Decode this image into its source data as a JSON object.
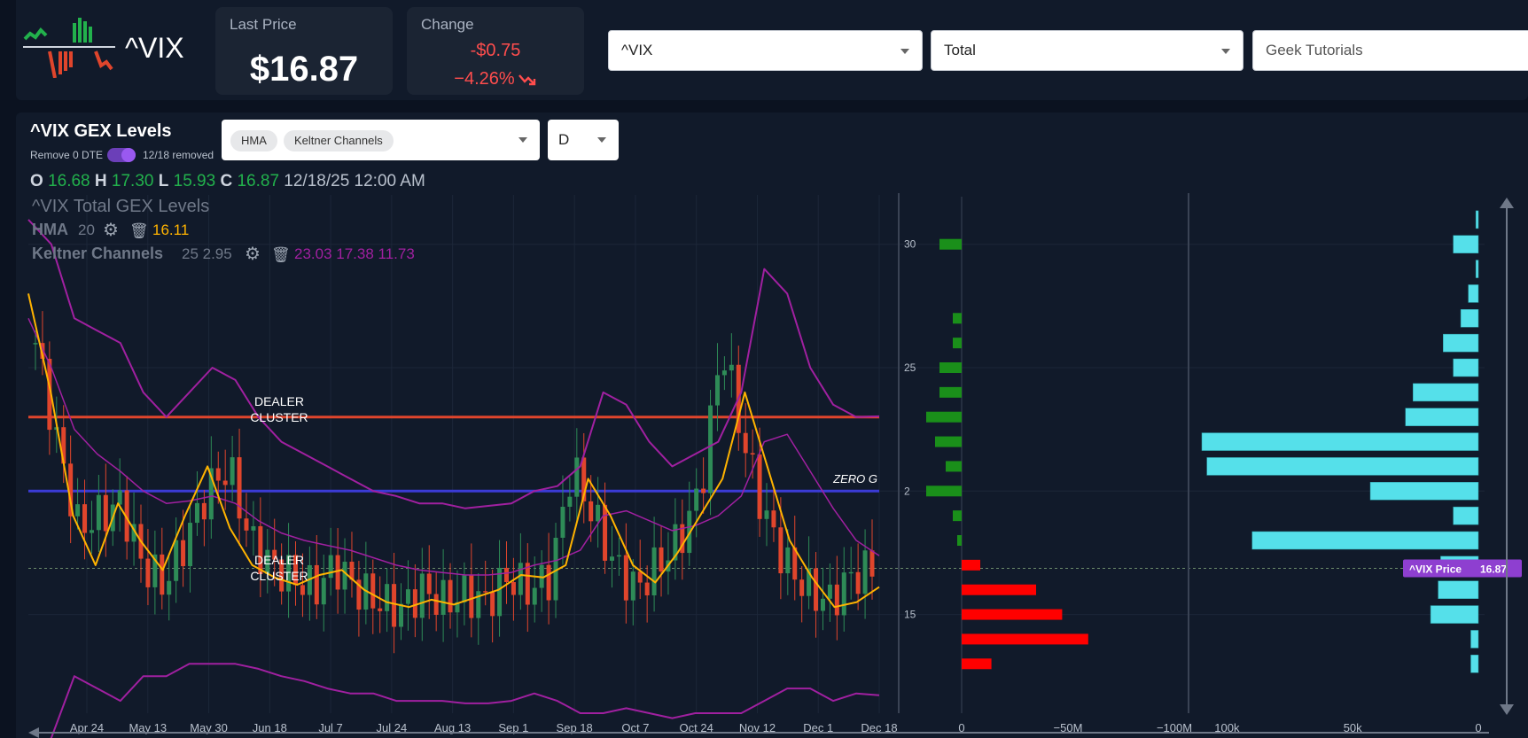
{
  "header": {
    "symbol": "^VIX",
    "last_price_label": "Last Price",
    "last_price": "$16.87",
    "change_label": "Change",
    "change_abs": "-$0.75",
    "change_pct": "−4.26%",
    "symbol_select": "^VIX",
    "gex_type_select": "Total",
    "tutorials_select": "Geek Tutorials"
  },
  "chart_panel": {
    "title": "^VIX GEX Levels",
    "remove_dte_label": "Remove 0 DTE",
    "removed_label": "12/18 removed",
    "indicator_chips": [
      "HMA",
      "Keltner Channels"
    ],
    "interval": "D",
    "ohlc": {
      "o": "16.68",
      "h": "17.30",
      "l": "15.93",
      "c": "16.87",
      "date": "12/18/25 12:00 AM"
    },
    "legend_series_title": "^VIX Total GEX Levels",
    "hma_label": "HMA",
    "hma_period": "20",
    "hma_value": "16.11",
    "keltner_label": "Keltner Channels",
    "keltner_params": "25 2.95",
    "keltner_values": "23.03 17.38 11.73",
    "annotations": {
      "dealer1": [
        "DEALER",
        "CLUSTER"
      ],
      "dealer2": [
        "DEALER",
        "CLUSTER"
      ],
      "zero_g": "ZERO G",
      "price_tag_label": "^VIX Price",
      "price_tag_value": "16.87"
    }
  },
  "colors": {
    "bull": "#2e8b57",
    "bear": "#e0452c",
    "hma": "#ffb300",
    "keltner": "#a020a0",
    "dealer_line": "#e0452c",
    "zero_line": "#3b3bd6",
    "gex_pos": "#1a8f1a",
    "gex_neg": "#ff0000",
    "oi": "#55e0ea",
    "price_tag": "#8e3fd0"
  },
  "chart_data": [
    {
      "type": "candlestick",
      "x_tick_labels": [
        "Apr 24",
        "May 13",
        "May 30",
        "Jun 18",
        "Jul 7",
        "Jul 24",
        "Aug 13",
        "Sep 1",
        "Sep 18",
        "Oct 7",
        "Oct 24",
        "Nov 12",
        "Dec 1",
        "Dec 18"
      ],
      "ylim": [
        11,
        32
      ],
      "levels": {
        "dealer_cluster_upper": 23,
        "zero_gamma": 20,
        "dealer_cluster_lower": 16.5
      },
      "approx_close_path": [
        26,
        22,
        18.5,
        19,
        19.5,
        17,
        16.2,
        18,
        20,
        21,
        18,
        17,
        16.5,
        16,
        17,
        16,
        15.5,
        15.2,
        16,
        15.5,
        15.8,
        15.5,
        16.5,
        16,
        16.5,
        21,
        19,
        17,
        16,
        17,
        18,
        20,
        26,
        22,
        19,
        17,
        16,
        15.5,
        16.5,
        16.87
      ],
      "hma_path": [
        28,
        24,
        19,
        17,
        19.5,
        18,
        16.8,
        19,
        21,
        18.5,
        17,
        16.5,
        16.2,
        16.6,
        16.8,
        16,
        15.5,
        15.3,
        15.6,
        15.4,
        15.7,
        16,
        16.6,
        16.5,
        17,
        20.5,
        19,
        17,
        16.3,
        17.5,
        19,
        20.5,
        24,
        21,
        18,
        16.5,
        15.3,
        15.5,
        16.11
      ],
      "keltner_upper": [
        31,
        30,
        27,
        26.5,
        26,
        24,
        23,
        24,
        25,
        24.5,
        23,
        22,
        21.5,
        21,
        20.5,
        20,
        19.8,
        19.5,
        19.5,
        19.3,
        19.4,
        19.5,
        20,
        20.2,
        21,
        24,
        23.5,
        22,
        21,
        21.5,
        22,
        24,
        29,
        28,
        25,
        23.5,
        23,
        23.03
      ],
      "keltner_middle": [
        27,
        25,
        22.5,
        21.5,
        20.8,
        20,
        19.5,
        19.6,
        19.8,
        19.5,
        18.8,
        18.3,
        18,
        17.8,
        17.6,
        17.3,
        17,
        16.8,
        16.7,
        16.6,
        16.6,
        16.7,
        17,
        17.2,
        17.6,
        19,
        19.2,
        18.8,
        18.4,
        18.6,
        19,
        19.8,
        22,
        22.3,
        20.8,
        19.3,
        18,
        17.38
      ],
      "keltner_lower": [
        9,
        10,
        12.5,
        12,
        11.5,
        12.5,
        12.5,
        13,
        13,
        13,
        12.8,
        12.5,
        12.3,
        12,
        11.8,
        11.8,
        11.5,
        11.5,
        11.5,
        11.4,
        11.4,
        11.5,
        11.8,
        11.5,
        11,
        11,
        11.2,
        11,
        10.8,
        11,
        11,
        11,
        11.5,
        12,
        12,
        11.5,
        11.8,
        11.73
      ]
    },
    {
      "type": "bar",
      "title": "Total GEX by strike",
      "strikes": [
        31,
        30,
        29,
        28,
        27,
        26,
        25,
        24,
        23,
        22,
        21,
        20,
        19,
        18,
        17,
        16,
        15,
        14,
        13
      ],
      "values_millions": [
        0,
        -25,
        0,
        0,
        -10,
        -10,
        -25,
        -25,
        -40,
        -30,
        -18,
        -40,
        -10,
        -5,
        5,
        20,
        27,
        34,
        8
      ],
      "x_ticks": [
        "0",
        "−50M",
        "−100M"
      ],
      "y_ticks": [
        "30",
        "25",
        "2",
        "15"
      ]
    },
    {
      "type": "bar",
      "title": "Open interest by strike",
      "strikes": [
        31,
        30,
        29,
        28,
        27,
        26,
        25,
        24,
        23,
        22,
        21,
        20,
        19,
        18,
        17,
        16,
        15,
        14,
        13
      ],
      "values_k": [
        1,
        10,
        1,
        4,
        7,
        14,
        10,
        26,
        29,
        110,
        108,
        43,
        10,
        90,
        15,
        16,
        19,
        3,
        3
      ],
      "x_ticks": [
        "100k",
        "50k",
        "0"
      ]
    }
  ]
}
